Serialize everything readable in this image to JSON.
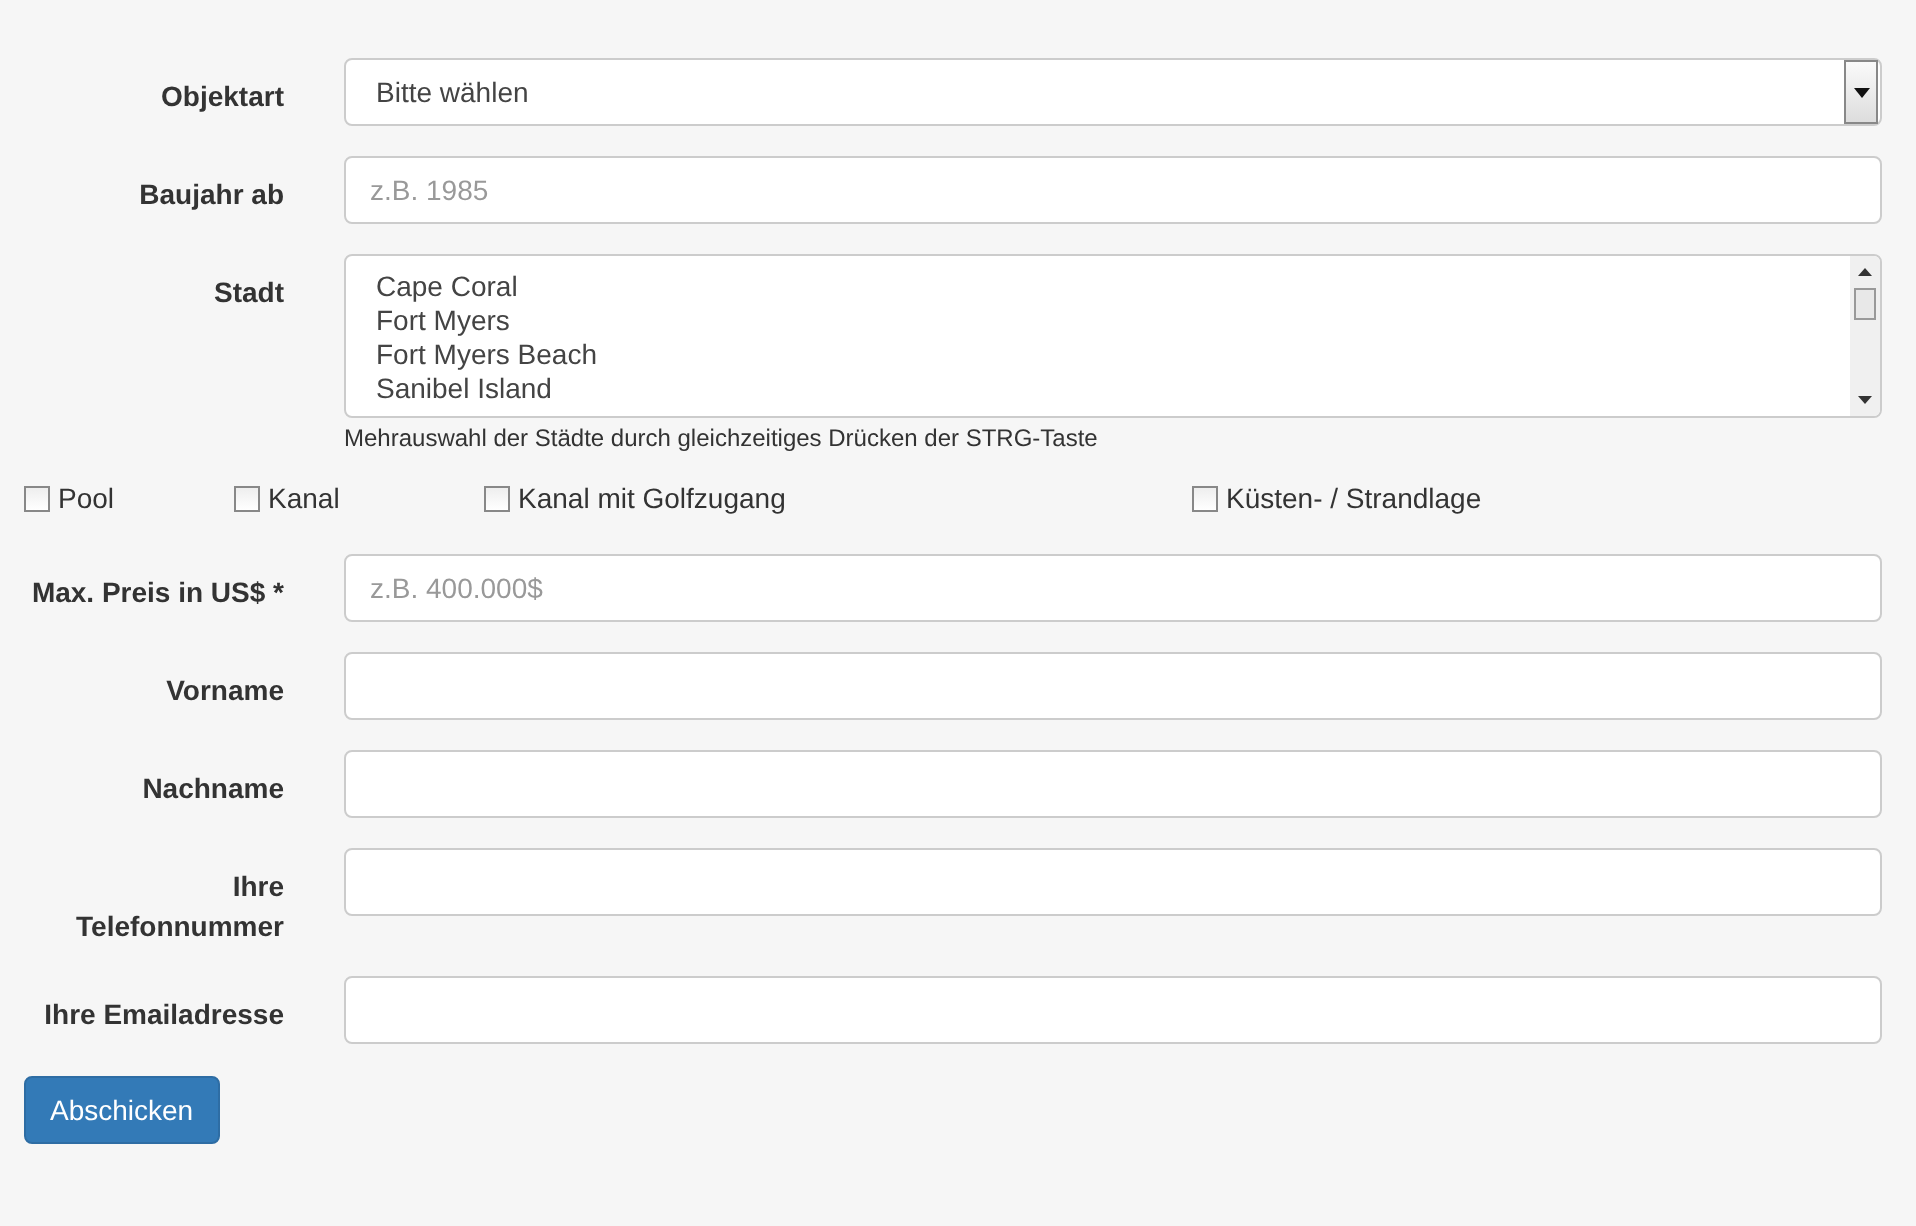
{
  "fields_top": [
    {
      "kind": "select",
      "label": "Objektart",
      "value": "Bitte wählen"
    },
    {
      "kind": "input",
      "label": "Baujahr ab",
      "placeholder": "z.B. 1985"
    },
    {
      "kind": "listbox",
      "label": "Stadt",
      "options": [
        "Cape Coral",
        "Fort Myers",
        "Fort Myers Beach",
        "Sanibel Island"
      ],
      "hint": "Mehrauswahl der Städte durch gleichzeitiges Drücken der STRG-Taste"
    }
  ],
  "checkboxes": [
    {
      "label": "Pool",
      "checked": false
    },
    {
      "label": "Kanal",
      "checked": false
    },
    {
      "label": "Kanal mit Golfzugang",
      "checked": false
    },
    {
      "label": "Küsten- / Strandlage",
      "checked": false
    }
  ],
  "fields_bottom": [
    {
      "kind": "input",
      "label": "Max. Preis in US$ *",
      "placeholder": "z.B. 400.000$"
    },
    {
      "kind": "input",
      "label": "Vorname"
    },
    {
      "kind": "input",
      "label": "Nachname"
    },
    {
      "kind": "input",
      "label": "Ihre Telefonnummer"
    },
    {
      "kind": "input",
      "label": "Ihre Emailadresse"
    }
  ],
  "submit": "Abschicken"
}
